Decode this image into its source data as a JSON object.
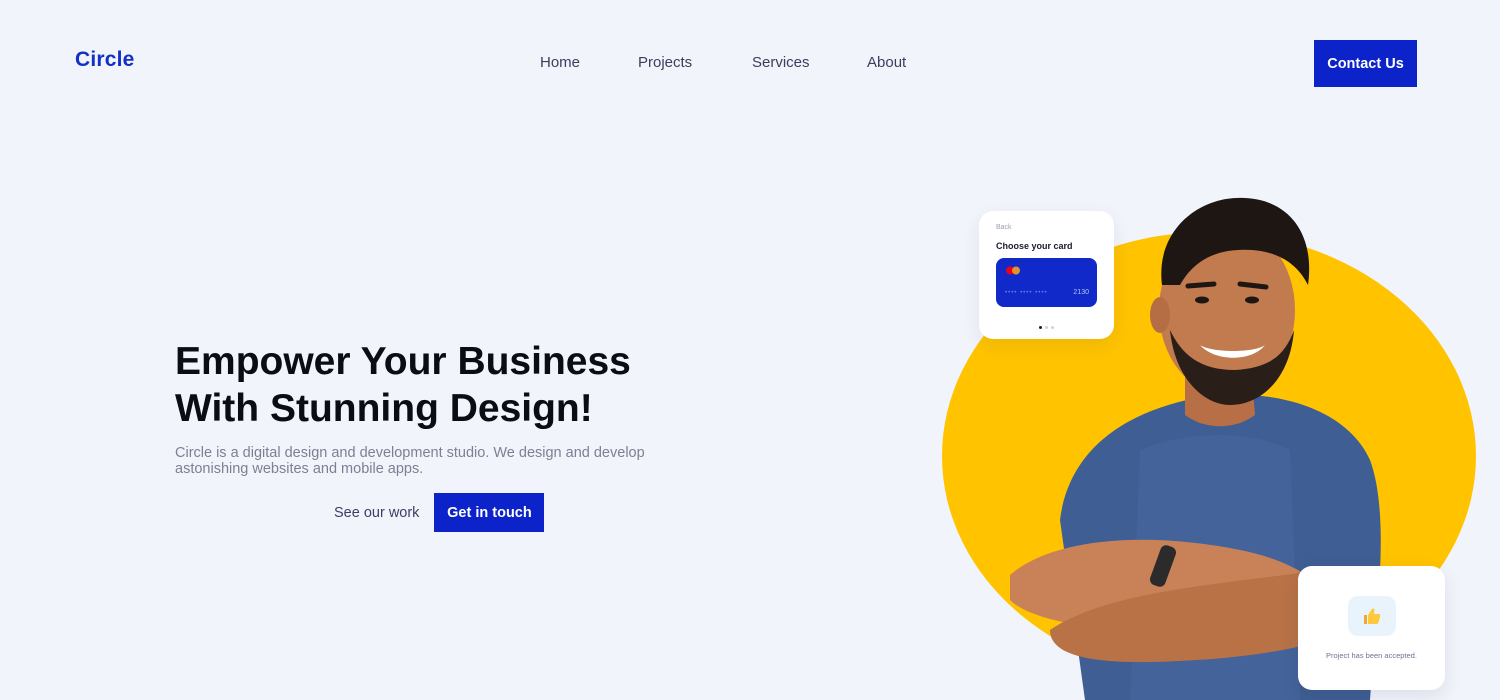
{
  "brand": {
    "logo_text": "Circle",
    "primary_color": "#0B23C9",
    "accent_color": "#FFC300",
    "background_color": "#F2F4FB"
  },
  "nav": {
    "items": [
      {
        "label": "Home"
      },
      {
        "label": "Projects"
      },
      {
        "label": "Services"
      },
      {
        "label": "About"
      }
    ],
    "contact_label": "Contact Us"
  },
  "hero": {
    "title_line1": "Empower Your Business",
    "title_line2": "With Stunning Design!",
    "description": "Circle is a digital design and development studio. We design and develop astonishing websites and mobile apps.",
    "secondary_cta": "See our work",
    "primary_cta": "Get in touch"
  },
  "card_widget": {
    "back_label": "Back",
    "title": "Choose your card",
    "card_masked": "•••• •••• ••••",
    "card_last4": "2130"
  },
  "accept_widget": {
    "icon": "thumbs-up-icon",
    "message": "Project has been accepted."
  }
}
